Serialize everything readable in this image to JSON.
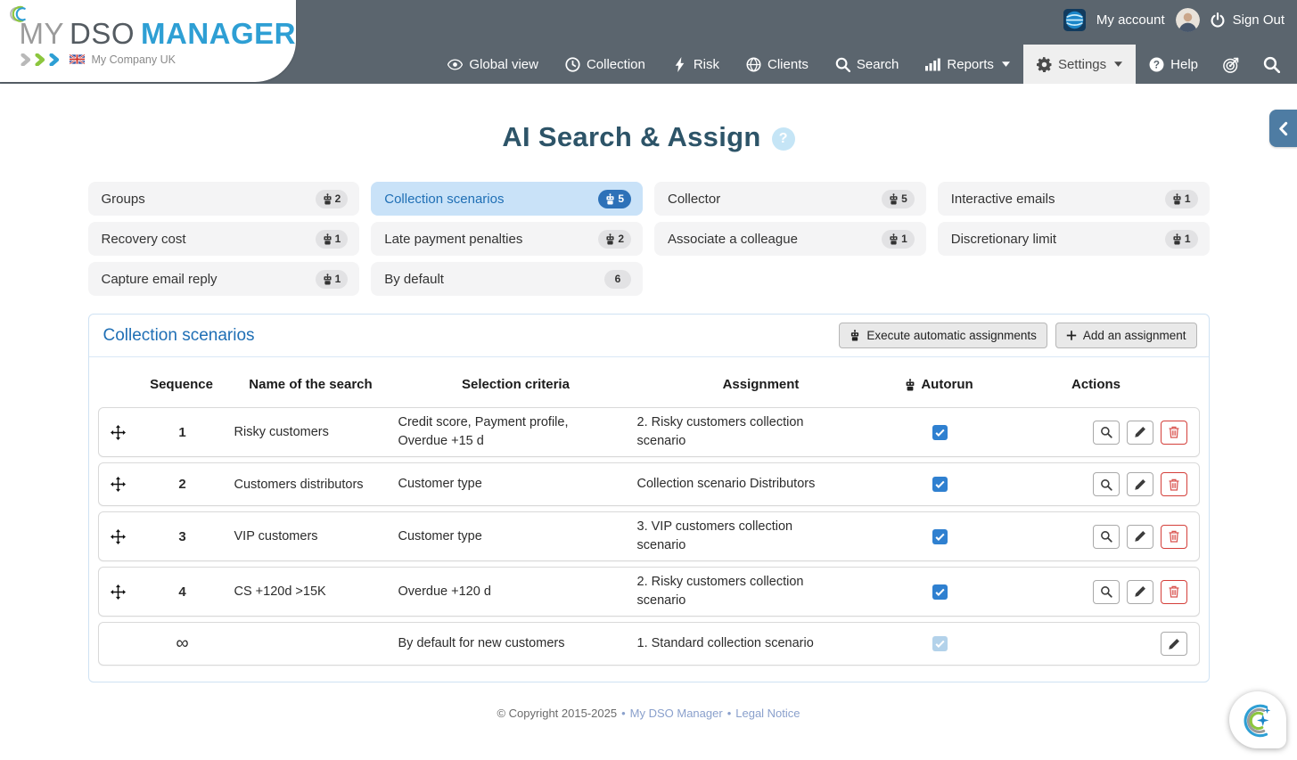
{
  "header": {
    "logo": {
      "word_my": "MY",
      "word_dso": "DSO",
      "word_manager": "MANAGER",
      "company": "My Company UK"
    },
    "account": {
      "my_account_label": "My account",
      "sign_out_label": "Sign Out"
    },
    "nav": [
      {
        "label": "Global view",
        "icon": "eye",
        "caret": false,
        "active": false
      },
      {
        "label": "Collection",
        "icon": "clock",
        "caret": false,
        "active": false
      },
      {
        "label": "Risk",
        "icon": "bolt",
        "caret": false,
        "active": false
      },
      {
        "label": "Clients",
        "icon": "globe",
        "caret": false,
        "active": false
      },
      {
        "label": "Search",
        "icon": "search",
        "caret": false,
        "active": false
      },
      {
        "label": "Reports",
        "icon": "chart",
        "caret": true,
        "active": false
      },
      {
        "label": "Settings",
        "icon": "gear",
        "caret": true,
        "active": true
      },
      {
        "label": "Help",
        "icon": "question",
        "caret": false,
        "active": false
      }
    ],
    "icon_buttons": [
      {
        "name": "target"
      },
      {
        "name": "search"
      }
    ],
    "colors": {
      "bar": "#5b656e",
      "brand_blue": "#2e9fd4",
      "brand_green": "#8cc63e"
    }
  },
  "page": {
    "title": "AI Search & Assign",
    "help_symbol": "?"
  },
  "tags": [
    {
      "label": "Groups",
      "count": "2",
      "robot": true,
      "active": false
    },
    {
      "label": "Collection scenarios",
      "count": "5",
      "robot": true,
      "active": true
    },
    {
      "label": "Collector",
      "count": "5",
      "robot": true,
      "active": false
    },
    {
      "label": "Interactive emails",
      "count": "1",
      "robot": true,
      "active": false
    },
    {
      "label": "Recovery cost",
      "count": "1",
      "robot": true,
      "active": false
    },
    {
      "label": "Late payment penalties",
      "count": "2",
      "robot": true,
      "active": false
    },
    {
      "label": "Associate a colleague",
      "count": "1",
      "robot": true,
      "active": false
    },
    {
      "label": "Discretionary limit",
      "count": "1",
      "robot": true,
      "active": false
    },
    {
      "label": "Capture email reply",
      "count": "1",
      "robot": true,
      "active": false
    },
    {
      "label": "By default",
      "count": "6",
      "robot": false,
      "active": false
    }
  ],
  "panel": {
    "title": "Collection scenarios",
    "execute_button": "Execute automatic assignments",
    "add_button": "Add an assignment"
  },
  "table": {
    "headers": [
      "Sequence",
      "Name of the search",
      "Selection criteria",
      "Assignment",
      "Autorun",
      "Actions"
    ],
    "rows": [
      {
        "sequence": "1",
        "name": "Risky customers",
        "criteria": "Credit score, Payment profile, Overdue +15 d",
        "assignment": "2. Risky customers collection scenario",
        "autorun_checked": true,
        "autorun_disabled": false,
        "draggable": true,
        "actions": [
          "view",
          "edit",
          "delete"
        ]
      },
      {
        "sequence": "2",
        "name": "Customers distributors",
        "criteria": "Customer type",
        "assignment": "Collection scenario Distributors",
        "autorun_checked": true,
        "autorun_disabled": false,
        "draggable": true,
        "actions": [
          "view",
          "edit",
          "delete"
        ]
      },
      {
        "sequence": "3",
        "name": "VIP customers",
        "criteria": "Customer type",
        "assignment": "3. VIP customers collection scenario",
        "autorun_checked": true,
        "autorun_disabled": false,
        "draggable": true,
        "actions": [
          "view",
          "edit",
          "delete"
        ]
      },
      {
        "sequence": "4",
        "name": "CS +120d >15K",
        "criteria": "Overdue +120 d",
        "assignment": "2. Risky customers collection scenario",
        "autorun_checked": true,
        "autorun_disabled": false,
        "draggable": true,
        "actions": [
          "view",
          "edit",
          "delete"
        ]
      },
      {
        "sequence": "∞",
        "name": "",
        "criteria": "By default for new customers",
        "assignment": "1. Standard collection scenario",
        "autorun_checked": true,
        "autorun_disabled": true,
        "draggable": false,
        "actions": [
          "edit"
        ]
      }
    ]
  },
  "footer": {
    "copyright": "© Copyright 2015-2025",
    "brand_link": "My DSO Manager",
    "legal_link": "Legal Notice",
    "separator": "•"
  },
  "colors": {
    "active_tag_bg": "#c9e2f8",
    "active_tag_text": "#1f6fb5",
    "badge_active_bg": "#2d71b8",
    "checkbox_checked": "#2f80d0",
    "checkbox_disabled": "#b3d2ea",
    "delete_red": "#d9534f",
    "panel_border": "#cfe2f3",
    "title_color": "#2d5468"
  }
}
